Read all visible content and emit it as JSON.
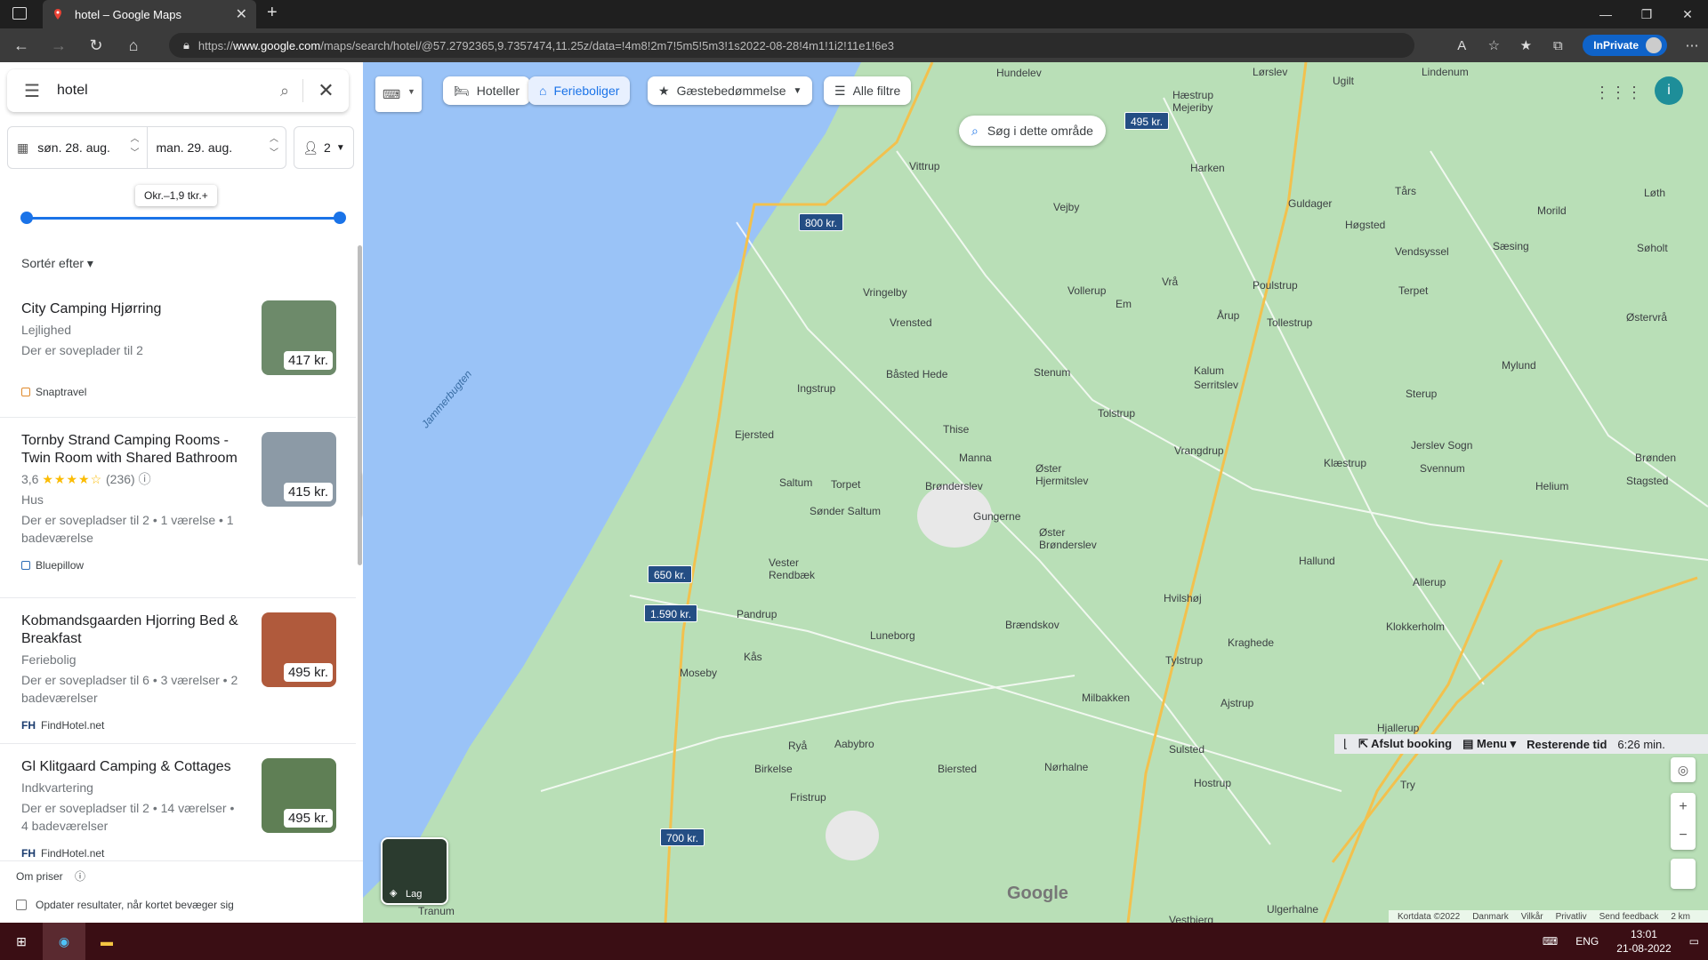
{
  "browser": {
    "tab_title": "hotel – Google Maps",
    "url_prefix": "https://",
    "url_host": "www.google.com",
    "url_rest": "/maps/search/hotel/@57.2792365,9.7357474,11.25z/data=!4m8!2m7!5m5!5m3!1s2022-08-28!4m1!1i2!11e1!6e3",
    "inprivate_label": "InPrivate"
  },
  "panel": {
    "query": "hotel",
    "checkin": "søn. 28. aug.",
    "checkout": "man. 29. aug.",
    "guests": "2",
    "price_tip": "Okr.–1,9 tkr.+",
    "sort_label": "Sortér efter",
    "results": [
      {
        "name": "City Camping Hjørring",
        "type": "Lejlighed",
        "desc": "Der er soveplader til 2",
        "source": "Snaptravel",
        "price": "417 kr.",
        "thumb_color": "#6d8a6a"
      },
      {
        "name": "Tornby Strand Camping Rooms - Twin Room with Shared Bathroom",
        "rating": "3,6",
        "stars": "★★★★☆",
        "reviews": "(236)",
        "type": "Hus",
        "desc": "Der er sovepladser til 2 • 1 værelse • 1 badeværelse",
        "source": "Bluepillow",
        "price": "415 kr.",
        "thumb_color": "#8c9aa6"
      },
      {
        "name": "Kobmandsgaarden Hjorring Bed & Breakfast",
        "type": "Feriebolig",
        "desc": "Der er sovepladser til 6 • 3 værelser • 2 badeværelser",
        "source": "FindHotel.net",
        "price": "495 kr.",
        "thumb_color": "#b05a3c"
      },
      {
        "name": "Gl Klitgaard Camping & Cottages",
        "type": "Indkvartering",
        "desc": "Der er sovepladser til 2 • 14 værelser • 4 badeværelser",
        "source": "FindHotel.net",
        "price": "495 kr.",
        "thumb_color": "#5f7f55"
      }
    ],
    "about_prices": "Om priser",
    "update_label": "Opdater resultater, når kortet bevæger sig"
  },
  "map": {
    "chips": [
      "Hoteller",
      "Ferieboliger",
      "Gæstebedømmelse",
      "Alle filtre"
    ],
    "search_area": "Søg i dette område",
    "price_pins": [
      "495 kr.",
      "800 kr.",
      "650 kr.",
      "1.590 kr.",
      "700 kr."
    ],
    "place_labels": [
      "Hundelev",
      "Lørslev",
      "Ugilt",
      "Lindenum",
      "Hæstrup Mejeriby",
      "Vittrup",
      "Harken",
      "Tårs",
      "Guldager",
      "Vejby",
      "Høgsted",
      "Morild",
      "Løth",
      "Vendsyssel",
      "Sæsing",
      "Søholt",
      "Vollerup",
      "Em",
      "Vrå",
      "Poulstrup",
      "Terpet",
      "Vringelby",
      "Vrensted",
      "Årup",
      "Tollestrup",
      "Østervrå",
      "Båsted Hede",
      "Stenum",
      "Kalum",
      "Serritslev",
      "Mylund",
      "Ingstrup",
      "Tolstrup",
      "Sterup",
      "Thise",
      "Ejersted",
      "Manna",
      "Vrangdrup",
      "Jerslev Sogn",
      "Klæstrup",
      "Brønden",
      "Øster Hjermitslev",
      "Brønderslev",
      "Svennum",
      "Saltum",
      "Torpet",
      "Stagsted",
      "Helium",
      "Sønder Saltum",
      "Gungerne",
      "Øster Brønderslev",
      "Vester Rendbæk",
      "Hallund",
      "Allerup",
      "Hvilshøj",
      "Pandrup",
      "Luneborg",
      "Brændskov",
      "Kraghede",
      "Klokkerholm",
      "Kås",
      "Moseby",
      "Tylstrup",
      "Milbakken",
      "Ajstrup",
      "Hjallerup",
      "Ryå",
      "Aabybro",
      "Birkelse",
      "Biersted",
      "Nørhalne",
      "Sulsted",
      "Hostrup",
      "Fristrup",
      "Try",
      "Tranum",
      "Vestbjerg",
      "Ulgerhalne",
      "Jammerbugten"
    ],
    "booking": {
      "exit": "Afslut booking",
      "menu": "Menu",
      "remaining": "Resterende tid",
      "time": "6:26 min."
    },
    "layer_label": "Lag",
    "google": "Google",
    "attribution": [
      "Kortdata ©2022",
      "Danmark",
      "Vilkår",
      "Privatliv",
      "Send feedback",
      "2 km"
    ]
  },
  "taskbar": {
    "lang": "ENG",
    "time": "13:01",
    "date": "21-08-2022"
  }
}
